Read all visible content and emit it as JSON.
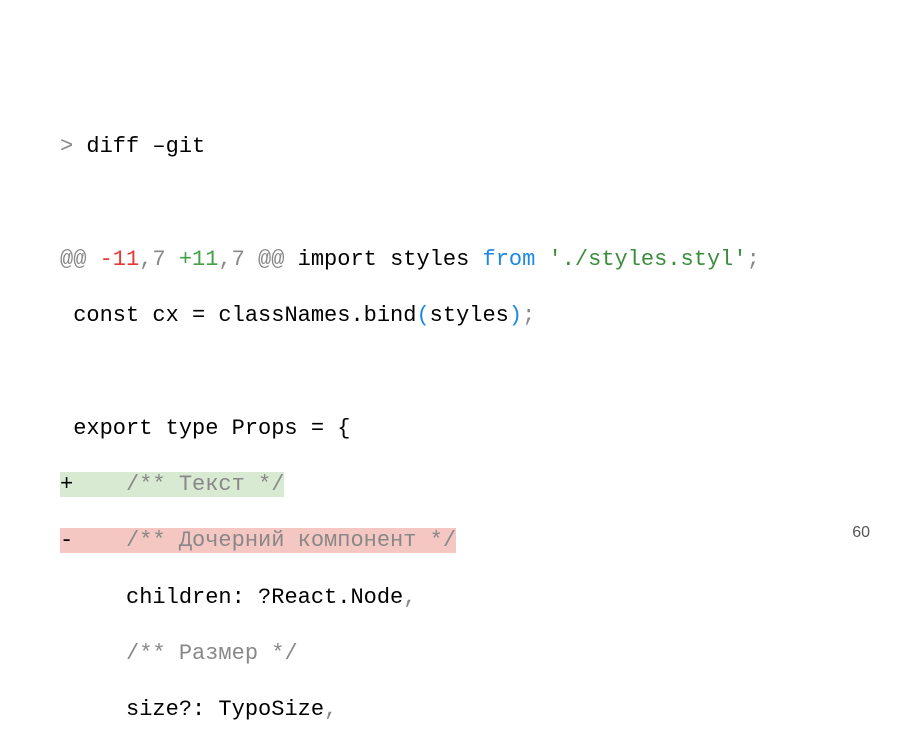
{
  "slide": {
    "page_number": "60"
  },
  "code": {
    "line1_prompt": "> ",
    "line1_cmd": "diff –git",
    "line2_hunk_open": "@@ ",
    "line2_minus": "-11",
    "line2_comma1": ",",
    "line2_seven1": "7",
    "line2_space": " ",
    "line2_plus": "+11",
    "line2_comma2": ",",
    "line2_seven2": "7",
    "line2_hunk_close": " @@",
    "line2_import": " import styles ",
    "line2_from": "from",
    "line2_space2": " ",
    "line2_string": "'./styles.styl'",
    "line2_semi": ";",
    "line3_indent": " ",
    "line3_const": "const cx = classNames.bind",
    "line3_paren_open": "(",
    "line3_styles": "styles",
    "line3_paren_close": ")",
    "line3_semi": ";",
    "line4_export": " export type Props = {",
    "line5_plus": "+",
    "line5_text": "    /** Текст */",
    "line6_minus": "-",
    "line6_text": "    /** Дочерний компонент */",
    "line7_indent": "     ",
    "line7_text": "children: ?React.Node",
    "line7_comma": ",",
    "line8_indent": "     ",
    "line8_comment": "/** Размер */",
    "line9_indent": "     ",
    "line9_text": "size?: TypoSize",
    "line9_comma": ","
  }
}
